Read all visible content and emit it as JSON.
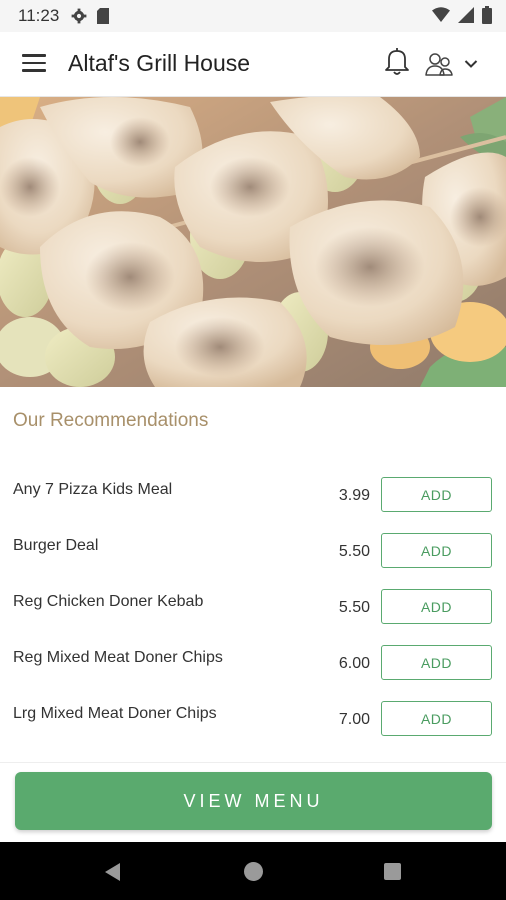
{
  "status_bar": {
    "time": "11:23",
    "left_icons": [
      "gear-icon",
      "sd-card-icon"
    ],
    "right_icons": [
      "wifi-icon",
      "signal-icon",
      "battery-icon"
    ]
  },
  "app_bar": {
    "title": "Altaf's Grill House",
    "icons": [
      "menu-icon",
      "bell-icon",
      "account-icon",
      "chevron-down-icon"
    ]
  },
  "hero": {
    "image": "grilled-chicken-skewers"
  },
  "recommendations": {
    "title": "Our Recommendations",
    "items": [
      {
        "name": "Any 7 Pizza Kids Meal",
        "price": "3.99",
        "button": "ADD"
      },
      {
        "name": "Burger Deal",
        "price": "5.50",
        "button": "ADD"
      },
      {
        "name": "Reg Chicken Doner Kebab",
        "price": "5.50",
        "button": "ADD"
      },
      {
        "name": "Reg Mixed Meat Doner Chips",
        "price": "6.00",
        "button": "ADD"
      },
      {
        "name": "Lrg Mixed Meat Doner Chips",
        "price": "7.00",
        "button": "ADD"
      }
    ]
  },
  "footer": {
    "view_menu": "VIEW MENU"
  },
  "nav_bar": {
    "icons": [
      "back-icon",
      "home-icon",
      "recents-icon"
    ]
  },
  "colors": {
    "accent_green": "#5aaa6e",
    "title_gold": "#a8906a",
    "status_bar_bg": "#f5f5f5"
  }
}
